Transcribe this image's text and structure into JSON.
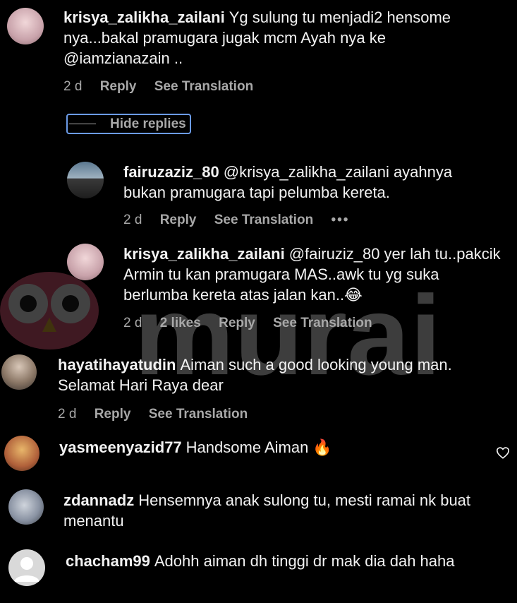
{
  "watermark": "murai",
  "comments": [
    {
      "username": "krisya_zalikha_zailani",
      "text": "Yg sulung tu menjadi2 hensome nya...bakal pramugara jugak mcm Ayah nya ke @iamzianazain ..",
      "time": "2 d",
      "reply": "Reply",
      "translate": "See Translation"
    },
    {
      "username": "hayatihayatudin",
      "text": "Aiman such a good looking young man. Selamat Hari Raya dear",
      "time": "2 d",
      "reply": "Reply",
      "translate": "See Translation"
    },
    {
      "username": "yasmeenyazid77",
      "text": "Handsome Aiman 🔥"
    },
    {
      "username": "zdannadz",
      "text": "Hensemnya anak sulong tu, mesti ramai nk buat menantu"
    },
    {
      "username": "chacham99",
      "text": "Adohh aiman dh tinggi dr mak dia dah haha"
    }
  ],
  "hide_replies": "Hide replies",
  "replies": [
    {
      "username": "fairuzaziz_80",
      "text": "@krisya_zalikha_zailani ayahnya bukan pramugara tapi pelumba kereta.",
      "time": "2 d",
      "reply": "Reply",
      "translate": "See Translation",
      "more": "•••"
    },
    {
      "username": "krisya_zalikha_zailani",
      "text": "@fairuziz_80 yer lah tu..pakcik Armin tu kan pramugara MAS..awk tu yg suka berlumba kereta atas jalan kan..😂",
      "time": "2 d",
      "likes": "2 likes",
      "reply": "Reply",
      "translate": "See Translation"
    }
  ],
  "colors": {
    "background": "#000000",
    "meta": "#a8a8a8",
    "focus_outline": "#6b9be8"
  }
}
